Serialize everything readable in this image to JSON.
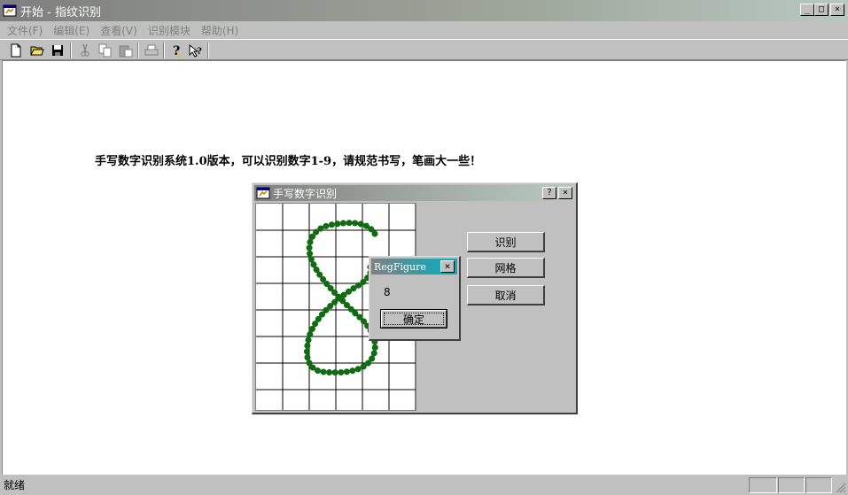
{
  "window": {
    "title": "开始 - 指纹识别",
    "icon": "app-icon",
    "controls": [
      "_",
      "□",
      "×"
    ]
  },
  "menu": {
    "items": [
      "文件(F)",
      "编辑(E)",
      "查看(V)",
      "识别模块",
      "帮助(H)"
    ]
  },
  "toolbar": {
    "buttons": [
      "new-file-icon",
      "open-folder-icon",
      "save-icon",
      "cut-icon",
      "copy-icon",
      "paste-icon",
      "print-icon",
      "help-icon",
      "context-help-icon"
    ]
  },
  "main": {
    "headline": "手写数字识别系统1.0版本，可以识别数字1-9，请规范书写，笔画大一些！"
  },
  "dialog": {
    "title": "手写数字识别",
    "help_label": "?",
    "close_label": "×",
    "buttons": {
      "recognize": "识别",
      "grid": "网格",
      "cancel": "取消"
    },
    "canvas": {
      "grid_rows": 8,
      "grid_cols": 6,
      "stroke_color": "#126b12",
      "drawn_digit": "8"
    }
  },
  "message_box": {
    "title": "RegFigure",
    "close_label": "×",
    "result": "8",
    "ok_label": "确定"
  },
  "statusbar": {
    "text": "就绪"
  },
  "colors": {
    "face": "#c0c0c0",
    "msg_title_accent": "#00b0c0"
  }
}
